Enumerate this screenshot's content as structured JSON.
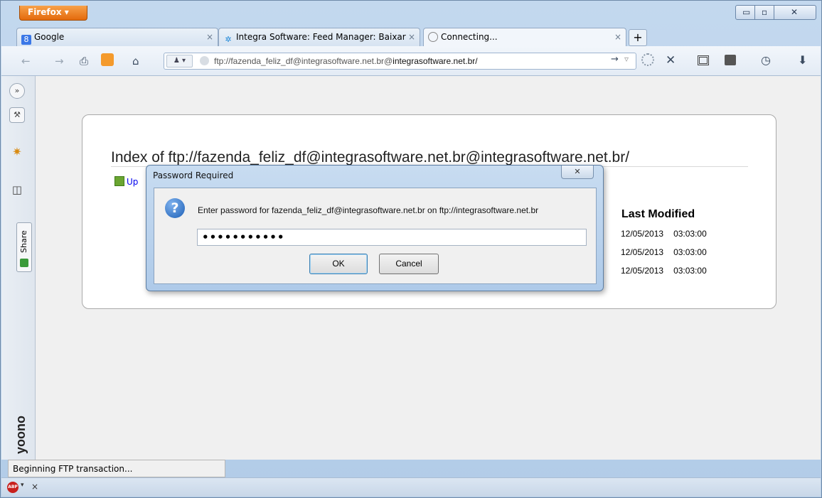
{
  "browser": {
    "menu_button": "Firefox ▾",
    "window_controls": {
      "minimize": "▭",
      "maximize": "▫",
      "close": "✕"
    }
  },
  "tabs": [
    {
      "label": "Google",
      "icon": "google-icon",
      "close": "×"
    },
    {
      "label": "Integra Software: Feed Manager: Baixar",
      "icon": "integra-star-icon",
      "close": "×"
    },
    {
      "label": "Connecting...",
      "icon": "loading-icon",
      "close": "×"
    }
  ],
  "new_tab": "+",
  "navbar": {
    "back": "←",
    "forward": "→",
    "print": "⎙",
    "home": "⌂",
    "identity": "♟ ▾",
    "url_prefix": "ftp://fazenda_feliz_df@integrasoftware.net.br@",
    "url_host": "integrasoftware.net.br/",
    "go": "→",
    "dropdown": "▿",
    "stop": "✕",
    "clock": "◷",
    "download": "⬇"
  },
  "sidebar": {
    "expand": "»",
    "share_label": "Share",
    "yoono_label": "yoono"
  },
  "page": {
    "title": "Index of ftp://fazenda_feliz_df@integrasoftware.net.br@integrasoftware.net.br/",
    "up_link": "Up",
    "last_modified_header": "Last Modified",
    "rows": [
      {
        "date": "12/05/2013",
        "time": "03:03:00"
      },
      {
        "date": "12/05/2013",
        "time": "03:03:00"
      },
      {
        "date": "12/05/2013",
        "time": "03:03:00"
      }
    ]
  },
  "dialog": {
    "title": "Password Required",
    "close": "✕",
    "message": "Enter password for fazenda_feliz_df@integrasoftware.net.br on ftp://integrasoftware.net.br",
    "password_mask": "•••••••••••",
    "ok_label": "OK",
    "cancel_label": "Cancel",
    "icon": "question-icon"
  },
  "status": {
    "text": "Beginning FTP transaction...",
    "abp_label": "ABP",
    "abp_close": "×"
  },
  "colors": {
    "accent": "#e46a0c",
    "link": "#0000ee",
    "frame": "#b9d1ea"
  }
}
